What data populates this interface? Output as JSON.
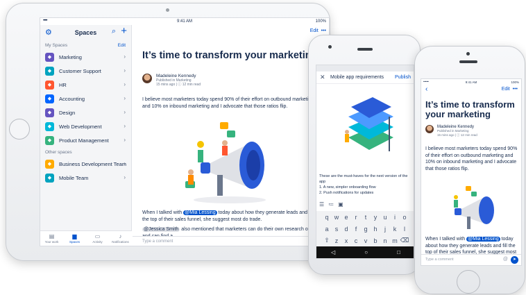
{
  "ipad": {
    "status": {
      "time": "9:41 AM",
      "signal": "•••••",
      "battery": "100%"
    },
    "sidebar": {
      "title": "Spaces",
      "my_spaces_label": "My Spaces",
      "edit_label": "Edit",
      "items": [
        {
          "label": "Marketing",
          "color": "#6554c0"
        },
        {
          "label": "Customer Support",
          "color": "#00a3bf"
        },
        {
          "label": "HR",
          "color": "#ff5630"
        },
        {
          "label": "Accounting",
          "color": "#0065ff"
        },
        {
          "label": "Design",
          "color": "#6554c0"
        },
        {
          "label": "Web Development",
          "color": "#00b8d9"
        },
        {
          "label": "Product Management",
          "color": "#36b37e"
        }
      ],
      "other_spaces_label": "Other spaces",
      "other_items": [
        {
          "label": "Business Development Team",
          "color": "#ffab00"
        },
        {
          "label": "Mobile Team",
          "color": "#00a3bf"
        }
      ]
    },
    "tabs": [
      "Your work",
      "Spaces",
      "Activity",
      "Notifications"
    ],
    "article": {
      "edit_label": "Edit",
      "more_label": "•••",
      "title": "It’s time to transform your marketing",
      "author": "Madeleine Kennedy",
      "published": "Published in Marketing",
      "read_time": "15 mins ago  |  ⓘ 12 min read",
      "para1": "I believe most marketers today spend 90% of their effort on outbound marketing and 10% on inbound marketing and I advocate that those ratios flip.",
      "para2_pre": "When I talked with ",
      "mention1": "@Mia Lessing",
      "para2_post": " today about how they generate leads and fill the top of their sales funnel, she suggest most do trade.",
      "mention2": "@Jessica Smith",
      "para3_post": " also mentioned that marketers can do their own research online and can find a.",
      "comment_placeholder": "Type a comment"
    }
  },
  "android": {
    "title": "Mobile app requirements",
    "publish": "Publish",
    "text_line1": "These are the must-haves for the next version of the app",
    "item1": "1. A new, simpler onboarding flow",
    "item2": "2. Push notifications for updates",
    "keyboard_rows": [
      [
        "q",
        "w",
        "e",
        "r",
        "t",
        "y",
        "u",
        "i",
        "o"
      ],
      [
        "a",
        "s",
        "d",
        "f",
        "g",
        "h",
        "j",
        "k",
        "l"
      ],
      [
        "⇧",
        "z",
        "x",
        "c",
        "v",
        "b",
        "n",
        "m",
        "⌫"
      ]
    ]
  },
  "iphone": {
    "status": {
      "time": "9:41 AM",
      "signal": "•••••",
      "battery": "100%"
    },
    "edit": "Edit",
    "more": "•••",
    "title": "It’s time to transform your marketing",
    "author": "Madeleine Kennedy",
    "published": "Published in Marketing",
    "read_time": "15 mins ago  |  ⓘ 12 min read",
    "para1": "I believe most marketers today spend 90% of their effort on outbound marketing and 10% on inbound marketing and I advocate that those ratios flip.",
    "para2_pre": "When I talked with ",
    "mention": "@Mia Lessing",
    "para2_post": " today about how they generate leads and fill the top of their sales funnel, she suggest most",
    "comment_placeholder": "Type a comment"
  }
}
